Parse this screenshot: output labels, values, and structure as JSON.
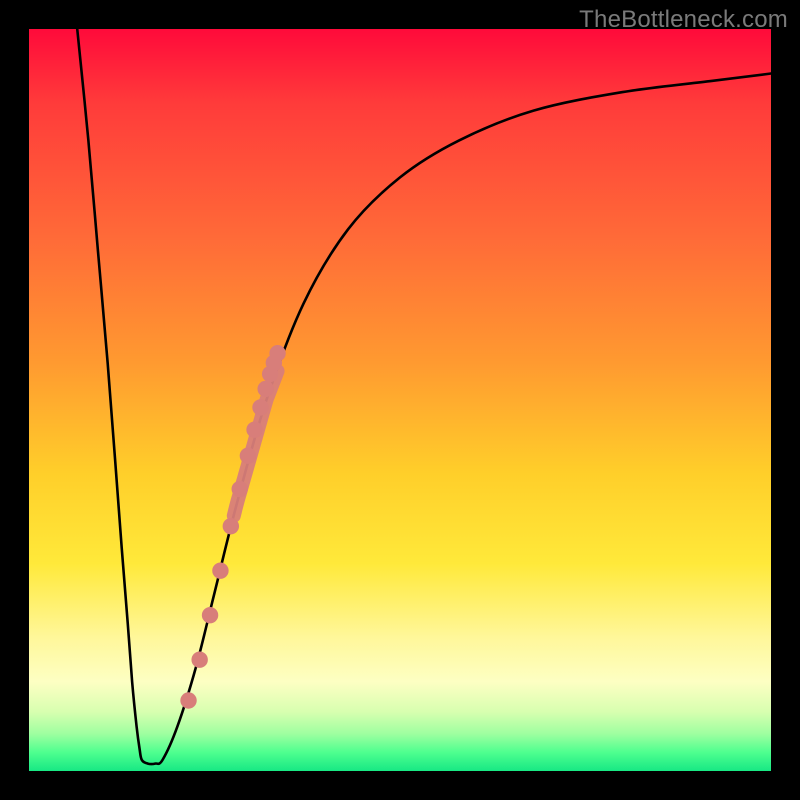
{
  "watermark": "TheBottleneck.com",
  "colors": {
    "frame": "#000000",
    "curve": "#000000",
    "dot_fill": "#d87e7a",
    "dot_stroke": "#c96d68",
    "highlight_stroke": "#d87e7a"
  },
  "chart_data": {
    "type": "line",
    "title": "",
    "xlabel": "",
    "ylabel": "",
    "xlim": [
      0,
      100
    ],
    "ylim": [
      0,
      100
    ],
    "series": [
      {
        "name": "left-descent",
        "x": [
          6.5,
          8.0,
          9.3,
          10.6,
          11.6,
          12.5,
          13.3,
          13.9,
          14.5,
          14.9,
          15.2
        ],
        "y": [
          100,
          85,
          70,
          55,
          42,
          30,
          20,
          12,
          6,
          3,
          1.5
        ]
      },
      {
        "name": "valley-floor",
        "x": [
          15.2,
          16.0,
          17.0,
          18.0
        ],
        "y": [
          1.5,
          1.0,
          1.0,
          1.5
        ]
      },
      {
        "name": "right-rise",
        "x": [
          18.0,
          20.0,
          22.5,
          25.0,
          28.0,
          32.0,
          37.0,
          43.0,
          50.0,
          58.0,
          68.0,
          80.0,
          92.0,
          100.0
        ],
        "y": [
          1.5,
          6,
          14,
          24,
          36,
          50,
          63,
          73,
          80,
          85,
          89,
          91.5,
          93,
          94
        ]
      }
    ],
    "dots": {
      "name": "marked-points",
      "x": [
        21.5,
        23.0,
        24.4,
        25.8,
        27.2,
        28.4,
        29.5,
        30.4,
        31.2,
        31.9,
        32.5,
        33.0,
        33.5
      ],
      "y": [
        9.5,
        15,
        21,
        27,
        33,
        38,
        42.5,
        46,
        49,
        51.5,
        53.5,
        55,
        56.3
      ]
    },
    "highlight_band": {
      "along_series": "right-rise",
      "x_start": 27.6,
      "x_end": 33.5
    }
  }
}
